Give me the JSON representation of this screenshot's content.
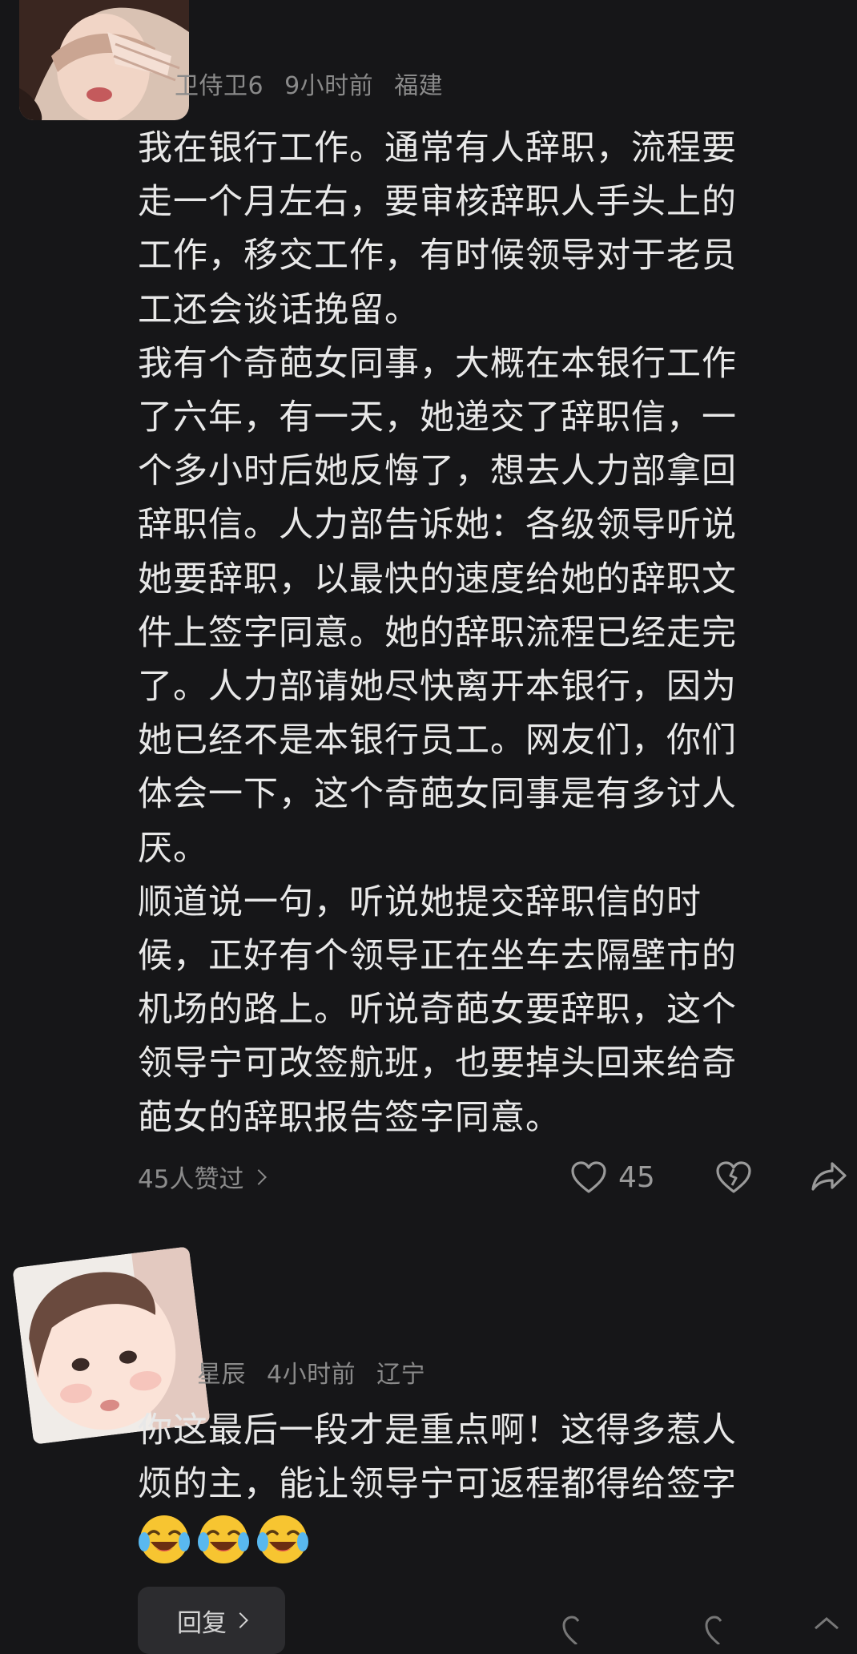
{
  "comments": [
    {
      "username": "卫侍卫6",
      "time": "9小时前",
      "location": "福建",
      "lines": [
        "我在银行工作。通常有人辞职，流程要",
        "走一个月左右，要审核辞职人手头上的",
        "工作，移交工作，有时候领导对于老员",
        "工还会谈话挽留。",
        "我有个奇葩女同事，大概在本银行工作",
        "了六年，有一天，她递交了辞职信，一",
        "个多小时后她反悔了，想去人力部拿回",
        "辞职信。人力部告诉她：各级领导听说",
        "她要辞职，以最快的速度给她的辞职文",
        "件上签字同意。她的辞职流程已经走完",
        "了。人力部请她尽快离开本银行，因为",
        "她已经不是本银行员工。网友们，你们",
        "体会一下，这个奇葩女同事是有多讨人",
        "厌。",
        "顺道说一句，听说她提交辞职信的时",
        "候，正好有个领导正在坐车去隔壁市的",
        "机场的路上。听说奇葩女要辞职，这个",
        "领导宁可改签航班，也要掉头回来给奇",
        "葩女的辞职报告签字同意。"
      ],
      "likes_text": "45人赞过",
      "like_count": "45"
    },
    {
      "username": "星辰",
      "time": "4小时前",
      "location": "辽宁",
      "lines": [
        "你这最后一段才是重点啊！这得多惹人",
        "烦的主，能让领导宁可返程都得给签字"
      ],
      "emojis": [
        "laughing-crying-emoji",
        "laughing-crying-emoji",
        "laughing-crying-emoji"
      ],
      "reply_label": "回复"
    }
  ],
  "colors": {
    "background": "#161618",
    "text": "#e8e8e8",
    "meta": "#8a8a8a",
    "reply_bg": "#2c2c2f"
  },
  "icons": {
    "like": "heart-icon",
    "dislike": "broken-heart-icon",
    "share": "share-arrow-icon"
  }
}
